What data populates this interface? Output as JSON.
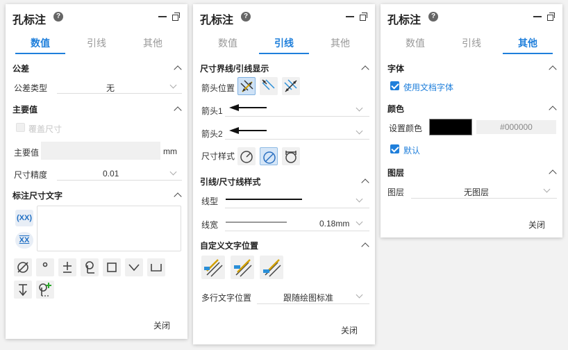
{
  "panel_title": "孔标注",
  "help_glyph": "?",
  "tabs": [
    "数值",
    "引线",
    "其他"
  ],
  "close_label": "关闭",
  "p1": {
    "tolerance_section": "公差",
    "tolerance_type_label": "公差类型",
    "tolerance_type_value": "无",
    "main_value_section": "主要值",
    "override_size_label": "覆盖尺寸",
    "main_value_label": "主要值",
    "main_value_input": "",
    "unit": "mm",
    "precision_label": "尺寸精度",
    "precision_value": "0.01",
    "annotation_text_section": "标注尺寸文字",
    "xx1": "(XX)",
    "xx2": "XX",
    "symbols": [
      "diameter",
      "degree",
      "plus-minus",
      "centerline",
      "square",
      "countersink",
      "counterbore",
      "depth",
      "add-symbol"
    ]
  },
  "p2": {
    "section1": "尺寸界线/引线显示",
    "arrow_position_label": "箭头位置",
    "arrow1_label": "箭头1",
    "arrow2_label": "箭头2",
    "dim_style_label": "尺寸样式",
    "section2": "引线/尺寸线样式",
    "line_type_label": "线型",
    "line_width_label": "线宽",
    "line_width_value": "0.18mm",
    "section3": "自定义文字位置",
    "multiline_label": "多行文字位置",
    "multiline_value": "跟随绘图标准"
  },
  "p3": {
    "font_section": "字体",
    "use_doc_font_label": "使用文档字体",
    "color_section": "颜色",
    "set_color_label": "设置颜色",
    "color_swatch": "#000000",
    "color_hex": "#000000",
    "default_label": "默认",
    "layer_section": "图层",
    "layer_label": "图层",
    "layer_value": "无图层"
  },
  "colors": {
    "accent": "#1f7fdb",
    "muted_tab": "#999999",
    "field_bg": "#f0f0f0"
  }
}
